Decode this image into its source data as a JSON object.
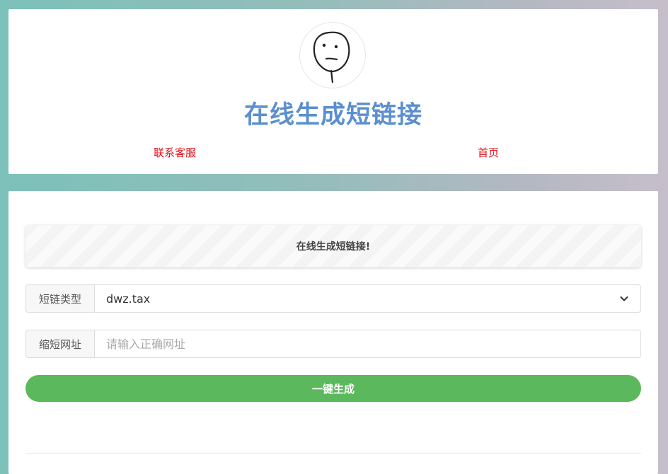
{
  "header": {
    "title": "在线生成短链接",
    "nav": {
      "contact": "联系客服",
      "home": "首页"
    },
    "title_color": "#5b8fcf",
    "link_color": "#e0101a"
  },
  "notice": {
    "text": "在线生成短链接!"
  },
  "form": {
    "type_label": "短链类型",
    "type_value": "dwz.tax",
    "url_label": "缩短网址",
    "url_placeholder": "请输入正确网址",
    "url_value": "",
    "submit_label": "一键生成",
    "submit_color": "#5cb85c"
  },
  "icons": {
    "avatar": "meme-face-icon",
    "select": "chevron-down-icon"
  }
}
